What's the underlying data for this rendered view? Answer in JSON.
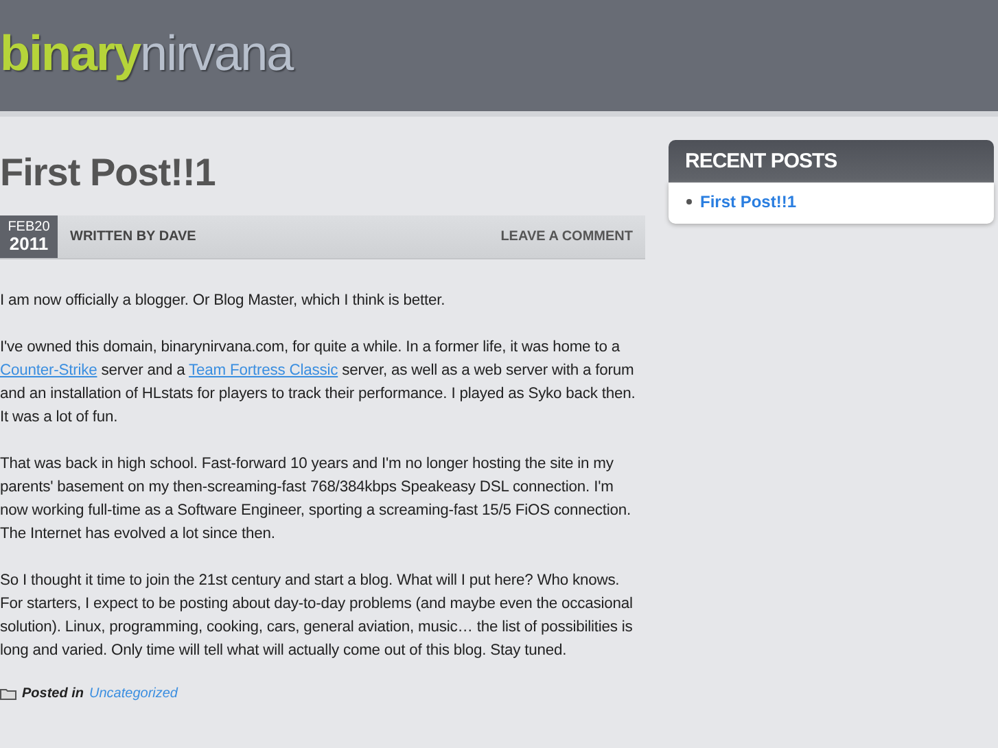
{
  "header": {
    "logo_bold": "binary",
    "logo_light": "nirvana"
  },
  "post": {
    "title": "First Post!!1",
    "date_month_day": "FEB20",
    "date_year": "2011",
    "byline": "WRITTEN BY DAVE",
    "comment_link": "LEAVE A COMMENT",
    "paragraphs": [
      [
        {
          "kind": "text",
          "text": "I am now officially a blogger. Or Blog Master, which I think is better."
        }
      ],
      [
        {
          "kind": "text",
          "text": "I've owned this domain, binarynirvana.com, for quite a while. In a former life, it was home to a "
        },
        {
          "kind": "link",
          "text": "Counter-Strike"
        },
        {
          "kind": "text",
          "text": " server and a "
        },
        {
          "kind": "link",
          "text": "Team Fortress Classic"
        },
        {
          "kind": "text",
          "text": " server, as well as a web server with a forum and an installation of HLstats for players to track their performance. I played as Syko back then. It was a lot of fun."
        }
      ],
      [
        {
          "kind": "text",
          "text": "That was back in high school. Fast-forward 10 years and I'm no longer hosting the site in my parents' basement on my then-screaming-fast 768/384kbps Speakeasy DSL connection. I'm now working full-time as a Software Engineer, sporting a screaming-fast 15/5 FiOS connection. The Internet has evolved a lot since then."
        }
      ],
      [
        {
          "kind": "text",
          "text": "So I thought it time to join the 21st century and start a blog. What will I put here? Who knows. For starters, I expect to be posting about day-to-day problems (and maybe even the occasional solution). Linux, programming, cooking, cars, general aviation, music… the list of possibilities is long and varied. Only time will tell what will actually come out of this blog. Stay tuned."
        }
      ]
    ],
    "posted_in_label": "Posted in",
    "category": "Uncategorized"
  },
  "sidebar": {
    "title": "RECENT POSTS",
    "items": [
      "First Post!!1"
    ]
  }
}
